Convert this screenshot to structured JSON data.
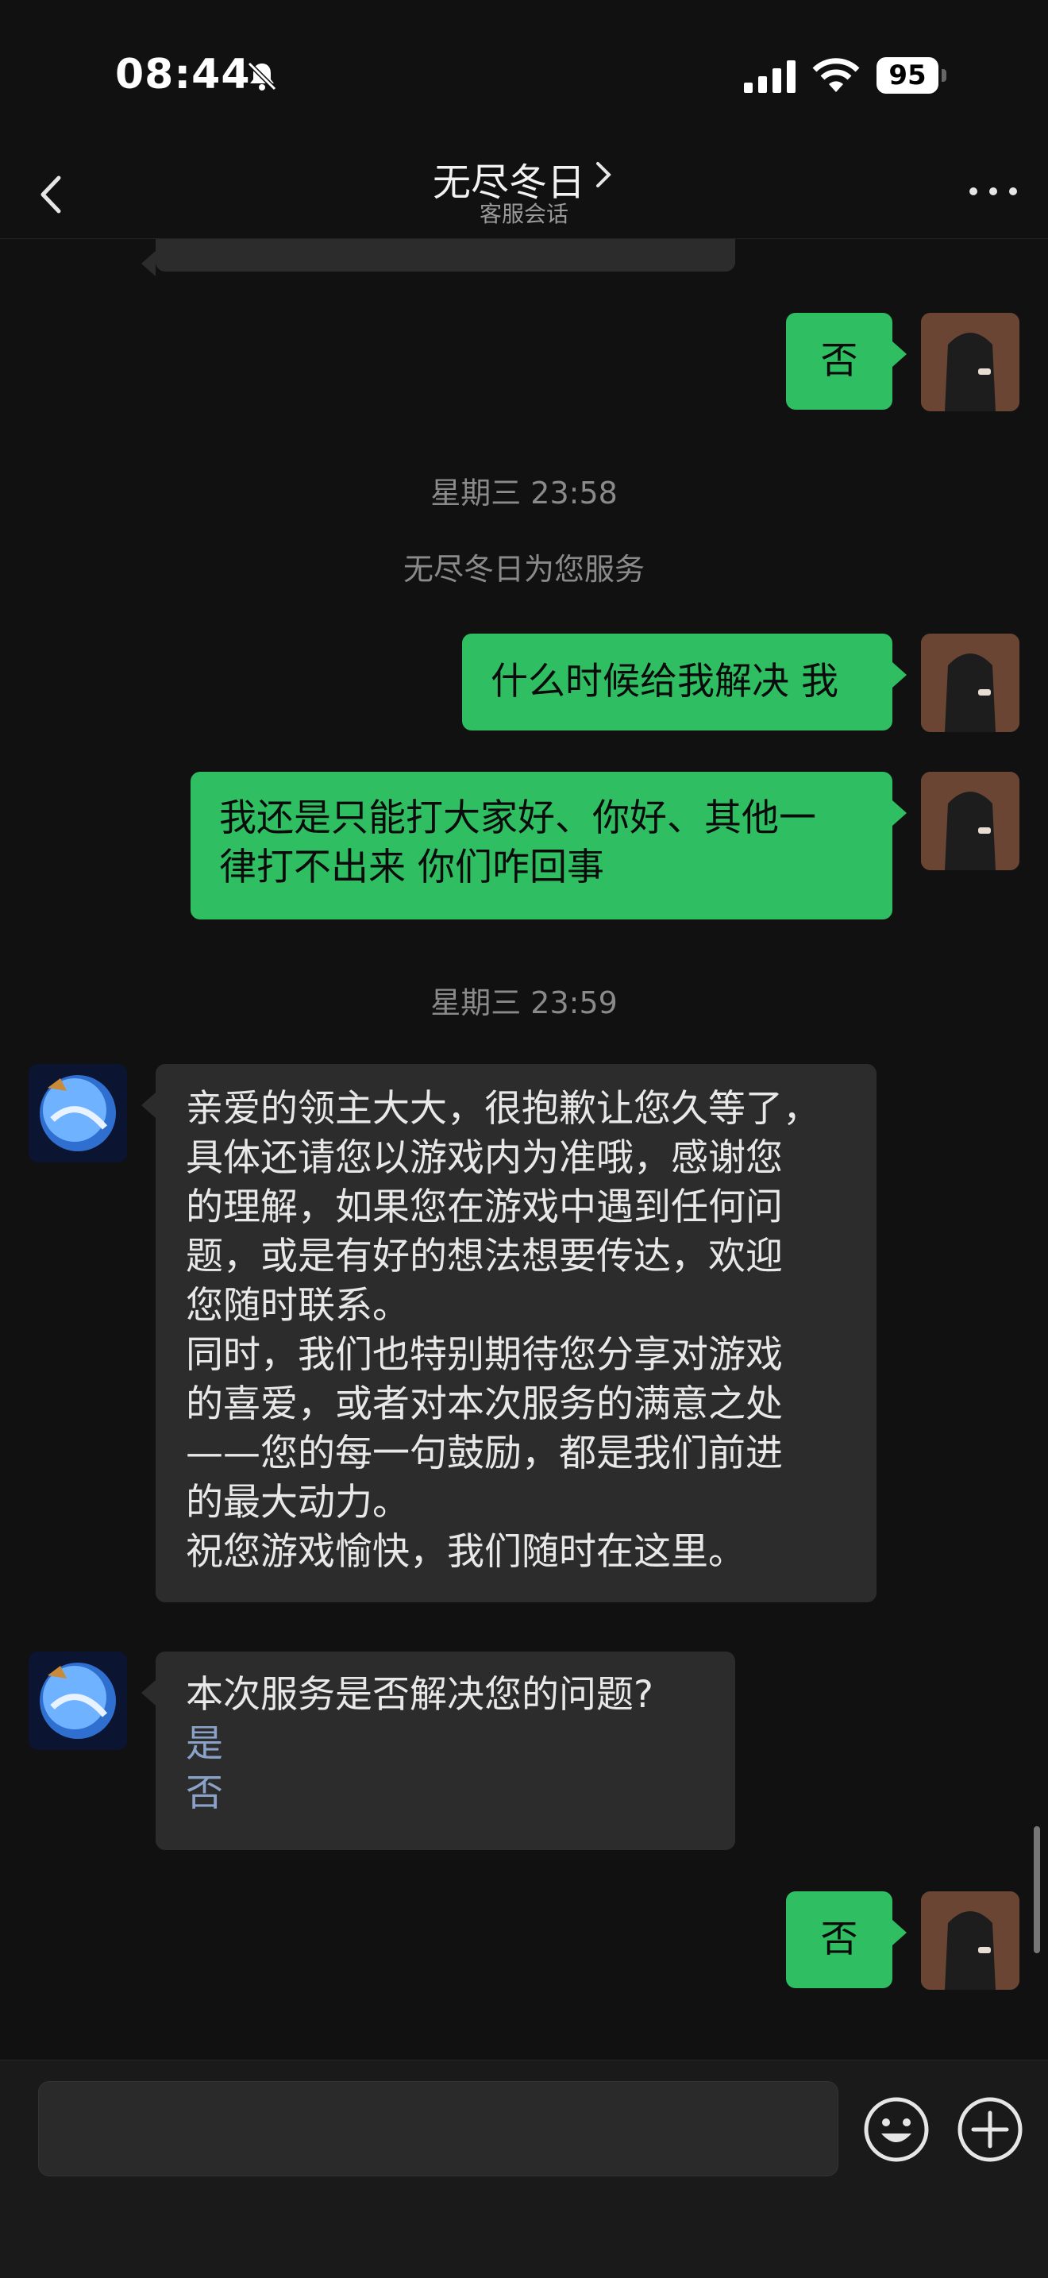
{
  "status": {
    "time": "08:44",
    "battery": "95"
  },
  "nav": {
    "title": "无尽冬日",
    "subtitle": "客服会话"
  },
  "messages": {
    "r_no_1": "否",
    "ts_1": "星期三 23:58",
    "service_note": "无尽冬日为您服务",
    "r_when": "什么时候给我解决 我",
    "r_only_line1": "我还是只能打大家好、你好、其他一",
    "r_only_line2": "律打不出来 你们咋回事",
    "ts_2": "星期三 23:59",
    "l_long_lines": [
      "亲爱的领主大大，很抱歉让您久等了，",
      "具体还请您以游戏内为准哦，感谢您",
      "的理解，如果您在游戏中遇到任何问",
      "题，或是有好的想法想要传达，欢迎",
      "您随时联系。",
      "同时，我们也特别期待您分享对游戏",
      "的喜爱，或者对本次服务的满意之处",
      "——您的每一句鼓励，都是我们前进",
      "的最大动力。",
      "祝您游戏愉快，我们随时在这里。"
    ],
    "l_question": "本次服务是否解决您的问题?",
    "l_opt_yes": "是",
    "l_opt_no": "否",
    "r_no_2": "否"
  },
  "icons": {
    "back": "chevron-left-icon",
    "more": "ellipsis-icon",
    "emoji": "smiley-icon",
    "plus": "plus-circle-icon",
    "mute": "bell-slash-icon"
  },
  "colors": {
    "bg": "#111111",
    "me_bubble": "#2fbf62",
    "them_bubble": "#2c2c2c",
    "link": "#8aa2c8"
  }
}
